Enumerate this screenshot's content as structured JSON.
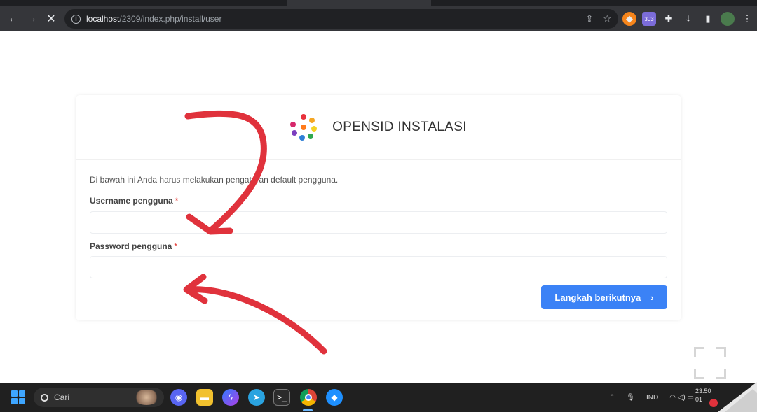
{
  "browser": {
    "url_host": "localhost",
    "url_rest": "/2309/index.php/install/user",
    "ext_badge": "303"
  },
  "page": {
    "title": "OPENSID INSTALASI",
    "intro": "Di bawah ini Anda harus melakukan pengaturan default pengguna.",
    "username_label": "Username pengguna",
    "password_label": "Password pengguna",
    "required_mark": "*",
    "username_value": "",
    "password_value": "",
    "next_button": "Langkah berikutnya"
  },
  "annotations": {
    "arrow_color": "#e0323c"
  },
  "taskbar": {
    "search_placeholder": "Cari",
    "language": "IND",
    "time": "23.50",
    "date": "01"
  },
  "colors": {
    "primary": "#3b82f6",
    "required": "#e3342f"
  }
}
